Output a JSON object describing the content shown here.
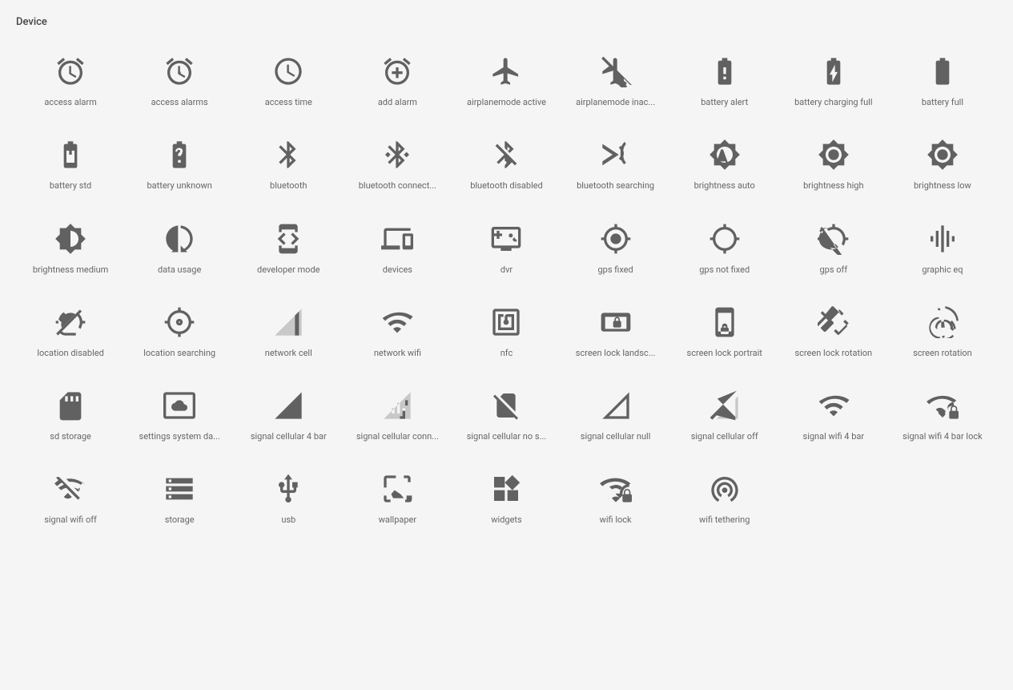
{
  "section": {
    "title": "Device"
  },
  "icons": [
    {
      "name": "access-alarm",
      "label": "access alarm"
    },
    {
      "name": "access-alarms",
      "label": "access alarms"
    },
    {
      "name": "access-time",
      "label": "access time"
    },
    {
      "name": "add-alarm",
      "label": "add alarm"
    },
    {
      "name": "airplanemode-active",
      "label": "airplanemode active"
    },
    {
      "name": "airplanemode-inactive",
      "label": "airplanemode inac..."
    },
    {
      "name": "battery-alert",
      "label": "battery alert"
    },
    {
      "name": "battery-charging-full",
      "label": "battery charging full"
    },
    {
      "name": "battery-full",
      "label": "battery full"
    },
    {
      "name": "battery-std",
      "label": "battery std"
    },
    {
      "name": "battery-unknown",
      "label": "battery unknown"
    },
    {
      "name": "bluetooth",
      "label": "bluetooth"
    },
    {
      "name": "bluetooth-connected",
      "label": "bluetooth connect..."
    },
    {
      "name": "bluetooth-disabled",
      "label": "bluetooth disabled"
    },
    {
      "name": "bluetooth-searching",
      "label": "bluetooth searching"
    },
    {
      "name": "brightness-auto",
      "label": "brightness auto"
    },
    {
      "name": "brightness-high",
      "label": "brightness high"
    },
    {
      "name": "brightness-low",
      "label": "brightness low"
    },
    {
      "name": "brightness-medium",
      "label": "brightness medium"
    },
    {
      "name": "data-usage",
      "label": "data usage"
    },
    {
      "name": "developer-mode",
      "label": "developer mode"
    },
    {
      "name": "devices",
      "label": "devices"
    },
    {
      "name": "dvr",
      "label": "dvr"
    },
    {
      "name": "gps-fixed",
      "label": "gps fixed"
    },
    {
      "name": "gps-not-fixed",
      "label": "gps not fixed"
    },
    {
      "name": "gps-off",
      "label": "gps off"
    },
    {
      "name": "graphic-eq",
      "label": "graphic eq"
    },
    {
      "name": "location-disabled",
      "label": "location disabled"
    },
    {
      "name": "location-searching",
      "label": "location searching"
    },
    {
      "name": "network-cell",
      "label": "network cell"
    },
    {
      "name": "network-wifi",
      "label": "network wifi"
    },
    {
      "name": "nfc",
      "label": "nfc"
    },
    {
      "name": "screen-lock-landscape",
      "label": "screen lock landsc..."
    },
    {
      "name": "screen-lock-portrait",
      "label": "screen lock portrait"
    },
    {
      "name": "screen-lock-rotation",
      "label": "screen lock rotation"
    },
    {
      "name": "screen-rotation",
      "label": "screen rotation"
    },
    {
      "name": "sd-storage",
      "label": "sd storage"
    },
    {
      "name": "settings-system-daydream",
      "label": "settings system da..."
    },
    {
      "name": "signal-cellular-4-bar",
      "label": "signal cellular 4 bar"
    },
    {
      "name": "signal-cellular-connected",
      "label": "signal cellular conn..."
    },
    {
      "name": "signal-cellular-no-sim",
      "label": "signal cellular no s..."
    },
    {
      "name": "signal-cellular-null",
      "label": "signal cellular null"
    },
    {
      "name": "signal-cellular-off",
      "label": "signal cellular off"
    },
    {
      "name": "signal-wifi-4-bar",
      "label": "signal wifi 4 bar"
    },
    {
      "name": "signal-wifi-4-bar-lock",
      "label": "signal wifi 4 bar lock"
    },
    {
      "name": "signal-wifi-off",
      "label": "signal wifi off"
    },
    {
      "name": "storage",
      "label": "storage"
    },
    {
      "name": "usb",
      "label": "usb"
    },
    {
      "name": "wallpaper",
      "label": "wallpaper"
    },
    {
      "name": "widgets",
      "label": "widgets"
    },
    {
      "name": "wifi-lock",
      "label": "wifi lock"
    },
    {
      "name": "wifi-tethering",
      "label": "wifi tethering"
    }
  ]
}
